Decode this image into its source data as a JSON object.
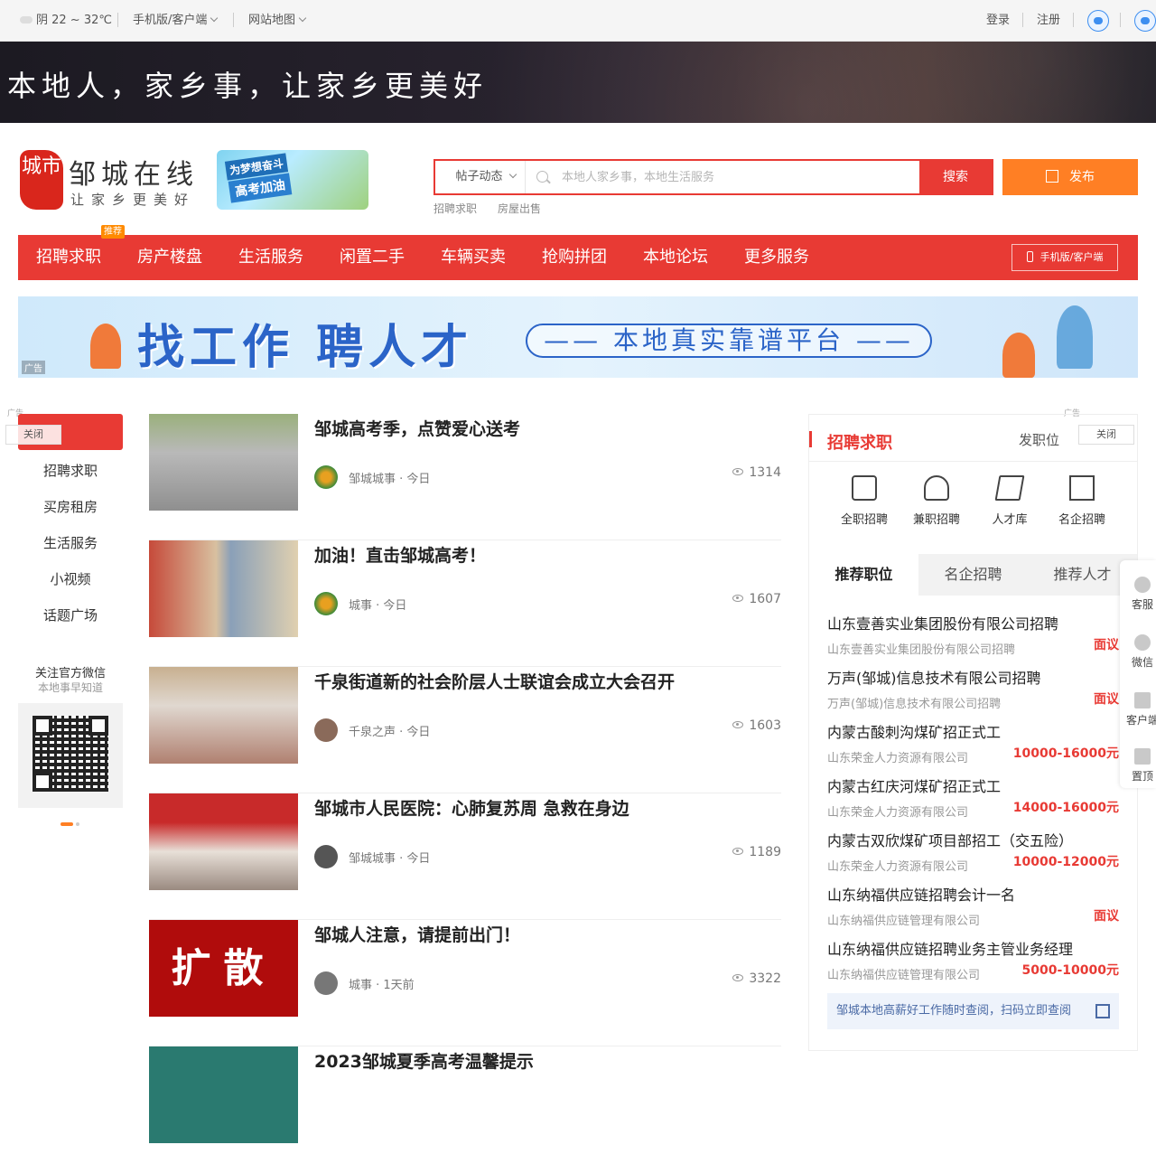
{
  "topbar": {
    "weather": "阴 22 ~ 32℃",
    "mobile": "手机版/客户端",
    "sitemap": "网站地图",
    "login": "登录",
    "register": "注册"
  },
  "banner": {
    "slogan": "本地人，家乡事，让家乡更美好"
  },
  "logo": {
    "seal": "城市",
    "name": "邹城在线",
    "tagline": "让家乡更美好"
  },
  "promo": {
    "line1": "为梦想奋斗",
    "line2": "高考加油"
  },
  "search": {
    "category": "帖子动态",
    "placeholder": "本地人家乡事，本地生活服务",
    "button": "搜索",
    "hot": [
      "招聘求职",
      "房屋出售"
    ]
  },
  "publish": {
    "label": "发布"
  },
  "nav": {
    "items": [
      "招聘求职",
      "房产楼盘",
      "生活服务",
      "闲置二手",
      "车辆买卖",
      "抢购拼团",
      "本地论坛",
      "更多服务"
    ],
    "tag": "推荐",
    "app": "手机版/客户端"
  },
  "ad": {
    "headline": "找工作 聘人才",
    "pill": "—— 本地真实靠谱平台 ——",
    "label": "广告"
  },
  "left": {
    "close": "关闭",
    "ad_label": "广告",
    "items": [
      "招聘求职",
      "买房租房",
      "生活服务",
      "小视频",
      "话题广场"
    ],
    "wechat_title": "关注官方微信",
    "wechat_sub": "本地事早知道"
  },
  "feed": [
    {
      "title": "邹城高考季，点赞爱心送考",
      "author": "邹城城事 · 今日",
      "views": "1314"
    },
    {
      "title": "加油！直击邹城高考！",
      "author": "城事 · 今日",
      "views": "1607"
    },
    {
      "title": "千泉街道新的社会阶层人士联谊会成立大会召开",
      "author": "千泉之声 · 今日",
      "views": "1603"
    },
    {
      "title": "邹城市人民医院：心肺复苏周 急救在身边",
      "author": "邹城城事 · 今日",
      "views": "1189"
    },
    {
      "title": "邹城人注意，请提前出门！",
      "author": "城事 · 1天前",
      "views": "3322",
      "thumb_text": "扩散"
    },
    {
      "title": "2023邹城夏季高考温馨提示"
    }
  ],
  "right": {
    "title": "招聘求职",
    "publish": "发职位",
    "close": "关闭",
    "ad_label": "广告",
    "categories": [
      "全职招聘",
      "兼职招聘",
      "人才库",
      "名企招聘"
    ],
    "tabs": [
      "推荐职位",
      "名企招聘",
      "推荐人才"
    ],
    "jobs": [
      {
        "title": "山东壹善实业集团股份有限公司招聘",
        "company": "山东壹善实业集团股份有限公司招聘",
        "salary": "面议"
      },
      {
        "title": "万声(邹城)信息技术有限公司招聘",
        "company": "万声(邹城)信息技术有限公司招聘",
        "salary": "面议"
      },
      {
        "title": "内蒙古酸刺沟煤矿招正式工",
        "company": "山东荣金人力资源有限公司",
        "salary": "10000-16000元"
      },
      {
        "title": "内蒙古红庆河煤矿招正式工",
        "company": "山东荣金人力资源有限公司",
        "salary": "14000-16000元"
      },
      {
        "title": "内蒙古双欣煤矿项目部招工（交五险）",
        "company": "山东荣金人力资源有限公司",
        "salary": "10000-12000元"
      },
      {
        "title": "山东纳福供应链招聘会计一名",
        "company": "山东纳福供应链管理有限公司",
        "salary": "面议"
      },
      {
        "title": "山东纳福供应链招聘业务主管业务经理",
        "company": "山东纳福供应链管理有限公司",
        "salary": "5000-10000元"
      }
    ],
    "footer": "邹城本地高薪好工作随时查阅，扫码立即查阅"
  },
  "float": [
    "客服",
    "微信",
    "客户端",
    "置顶"
  ],
  "colors": {
    "brand": "#e83a34",
    "publish": "#ff7f24"
  }
}
